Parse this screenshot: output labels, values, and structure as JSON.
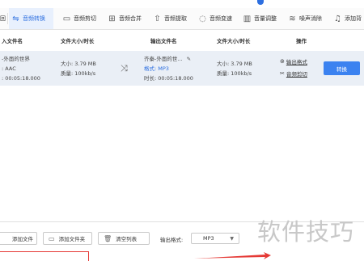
{
  "toolbar": {
    "items": [
      {
        "label": "回",
        "icon": "home-icon"
      },
      {
        "label": "音频转换",
        "icon": "convert-icon",
        "active": true
      },
      {
        "label": "音频剪切",
        "icon": "cut-icon"
      },
      {
        "label": "音频合并",
        "icon": "merge-icon"
      },
      {
        "label": "音频提取",
        "icon": "extract-icon"
      },
      {
        "label": "音频变速",
        "icon": "speed-icon"
      },
      {
        "label": "音量调整",
        "icon": "volume-icon"
      },
      {
        "label": "噪声消除",
        "icon": "noise-icon"
      },
      {
        "label": "添加背",
        "icon": "music-icon"
      }
    ]
  },
  "table": {
    "headers": {
      "input_file": "入文件名",
      "input_size": "文件大小/时长",
      "output_file": "输出文件名",
      "output_size": "文件大小/时长",
      "actions": "操作"
    },
    "row": {
      "input_name": "-外面的世界",
      "input_format": ": AAC",
      "input_duration": ": 00:05:18.000",
      "input_size": "大小: 3.79 MB",
      "input_quality": "质量: 100kb/s",
      "output_name": "齐秦-外面的世...",
      "output_format": "格式: MP3",
      "output_duration": "时长: 00:05:18.000",
      "output_size": "大小: 3.79 MB",
      "output_quality": "质量: 100kb/s",
      "action_output_format": "输出格式",
      "action_cut": "音频剪切",
      "convert_label": "转换"
    }
  },
  "bottom": {
    "add_file": "添加文件",
    "add_folder": "添加文件夹",
    "clear_list": "清空列表",
    "output_format_label": "输出格式:",
    "output_format_value": "MP3"
  },
  "watermark": "软件技巧",
  "colors": {
    "accent": "#2d6fe0",
    "button": "#3b82f0",
    "row_bg": "#eaeff6",
    "highlight": "#e53935"
  }
}
